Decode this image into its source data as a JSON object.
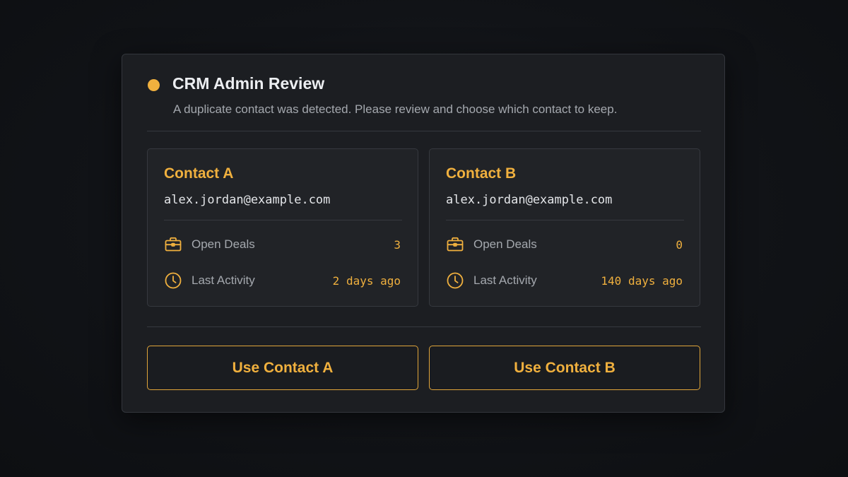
{
  "dialog": {
    "title": "CRM Admin Review",
    "subtitle": "A duplicate contact was detected. Please review and choose which contact to keep.",
    "accent_color": "#f0b03e"
  },
  "contacts": [
    {
      "title": "Contact A",
      "email": "alex.jordan@example.com",
      "open_deals_label": "Open Deals",
      "open_deals_icon": "briefcase-icon",
      "open_deals_value": "3",
      "last_activity_label": "Last Activity",
      "last_activity_icon": "clock-icon",
      "last_activity_value": "2 days ago"
    },
    {
      "title": "Contact B",
      "email": "alex.jordan@example.com",
      "open_deals_label": "Open Deals",
      "open_deals_icon": "briefcase-icon",
      "open_deals_value": "0",
      "last_activity_label": "Last Activity",
      "last_activity_icon": "clock-icon",
      "last_activity_value": "140 days ago"
    }
  ],
  "actions": {
    "use_a_label": "Use Contact A",
    "use_b_label": "Use Contact B"
  }
}
